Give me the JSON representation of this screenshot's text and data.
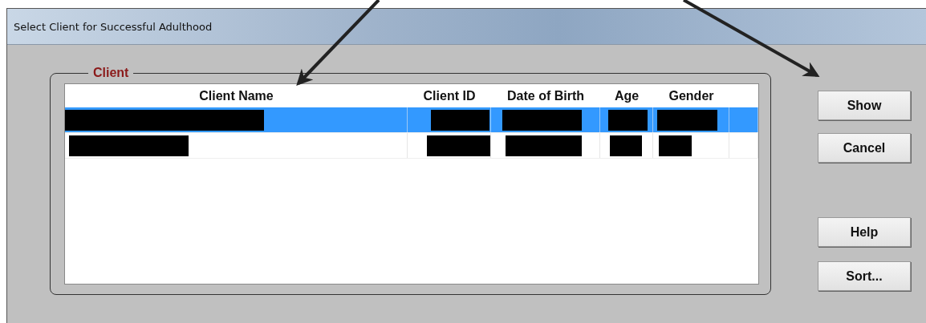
{
  "window": {
    "title": "Select Client for Successful Adulthood"
  },
  "group": {
    "label": "Client"
  },
  "table": {
    "columns": [
      "Client Name",
      "Client ID",
      "Date of Birth",
      "Age",
      "Gender"
    ],
    "rows": [
      {
        "selected": true
      },
      {
        "selected": false
      }
    ]
  },
  "buttons": [
    "Show",
    "Cancel",
    "Help",
    "Sort..."
  ]
}
